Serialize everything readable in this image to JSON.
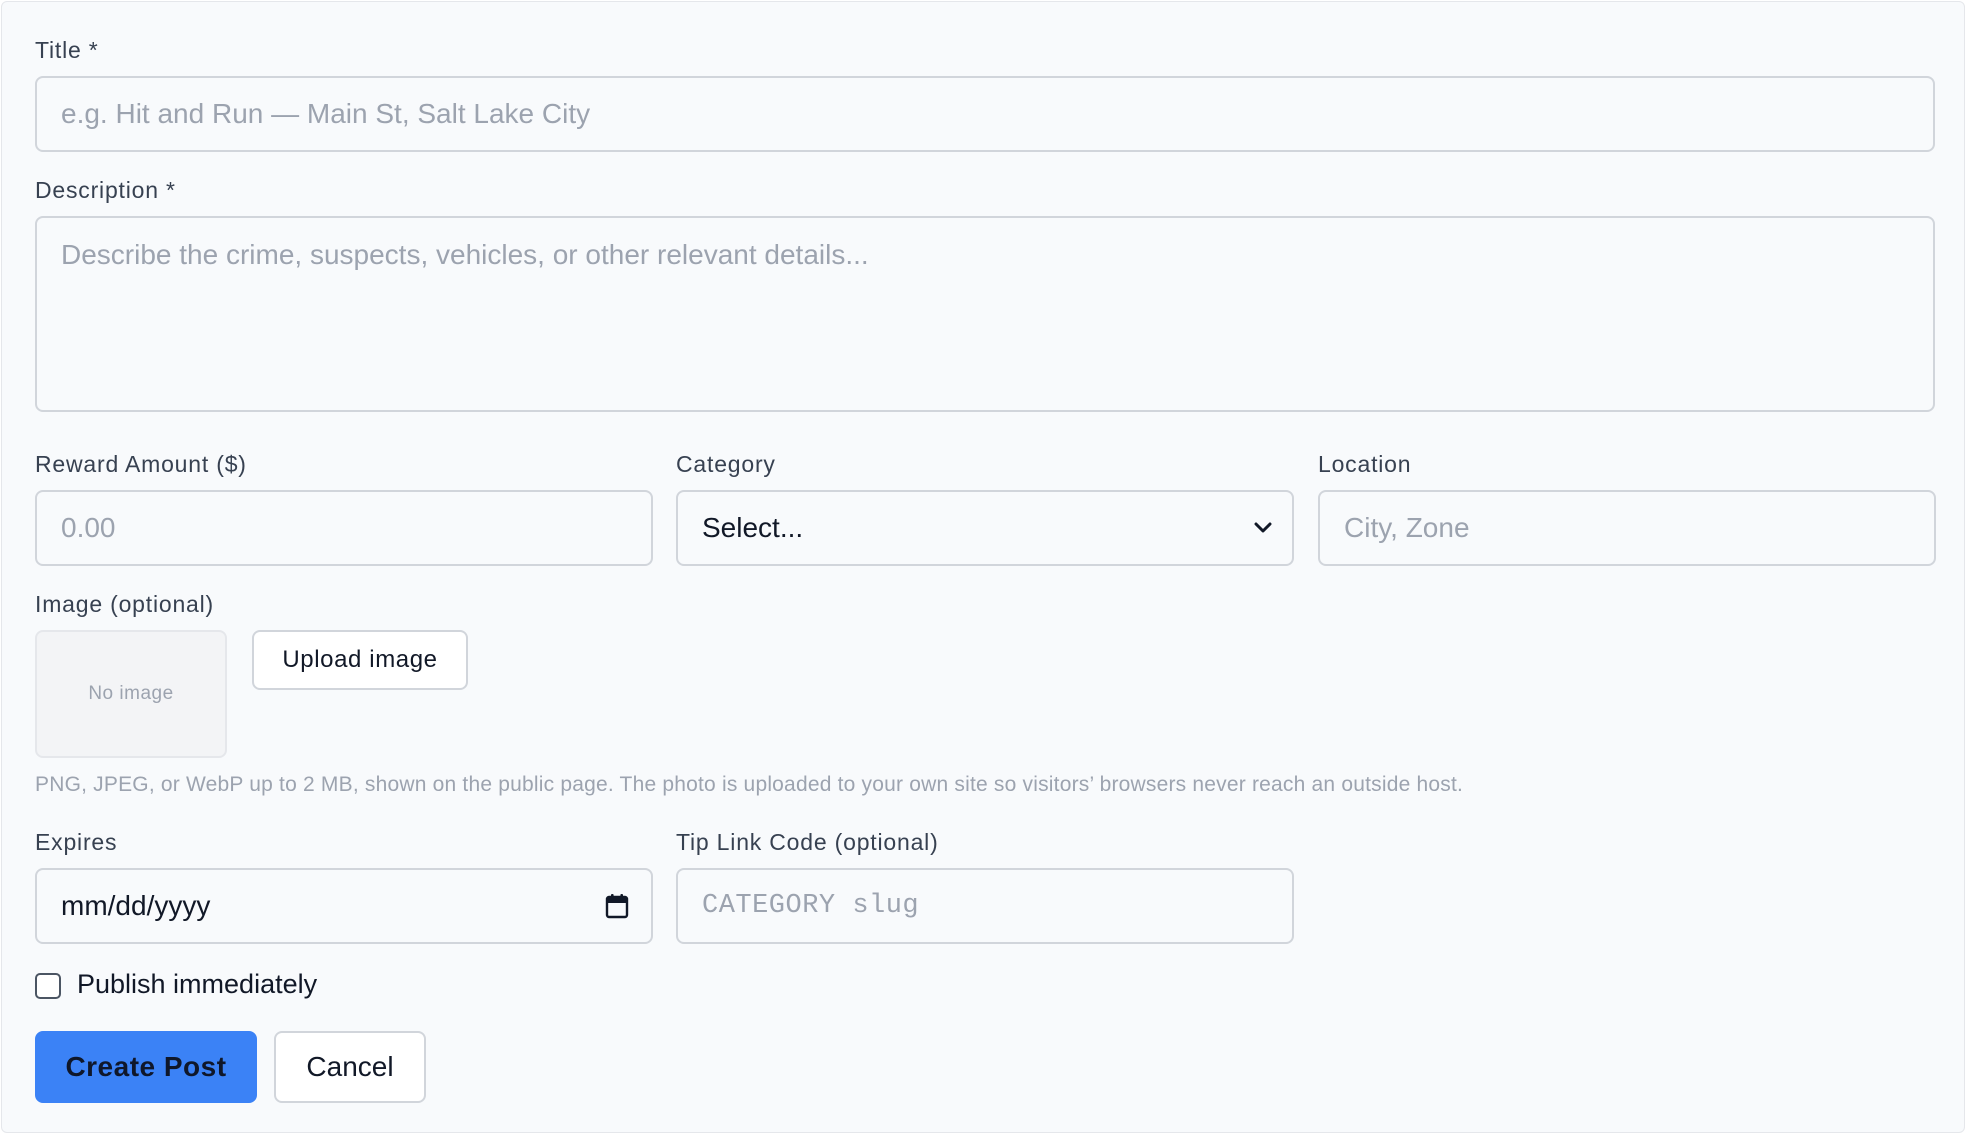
{
  "form": {
    "title": {
      "label": "Title *",
      "placeholder": "e.g. Hit and Run — Main St, Salt Lake City",
      "value": ""
    },
    "description": {
      "label": "Description *",
      "placeholder": "Describe the crime, suspects, vehicles, or other relevant details...",
      "value": ""
    },
    "reward": {
      "label": "Reward Amount ($)",
      "placeholder": "0.00",
      "value": ""
    },
    "category": {
      "label": "Category",
      "selected": "Select...",
      "icon": "chevron-down-icon"
    },
    "location": {
      "label": "Location",
      "placeholder": "City, Zone",
      "value": ""
    },
    "image": {
      "label": "Image (optional)",
      "thumbnail_text": "No image",
      "upload_label": "Upload image",
      "help": "PNG, JPEG, or WebP up to 2 MB, shown on the public page. The photo is uploaded to your own site so visitors’ browsers never reach an outside host."
    },
    "expires": {
      "label": "Expires",
      "value": "mm/dd/yyyy",
      "icon": "calendar-icon"
    },
    "tip_code": {
      "label": "Tip Link Code (optional)",
      "placeholder": "CATEGORY slug",
      "value": ""
    },
    "publish": {
      "label": "Publish immediately",
      "checked": false
    },
    "actions": {
      "submit_label": "Create Post",
      "cancel_label": "Cancel"
    }
  },
  "colors": {
    "primary": "#3b82f6",
    "background": "#f8fafc",
    "border": "#d1d5db",
    "placeholder": "#9ca3af"
  }
}
